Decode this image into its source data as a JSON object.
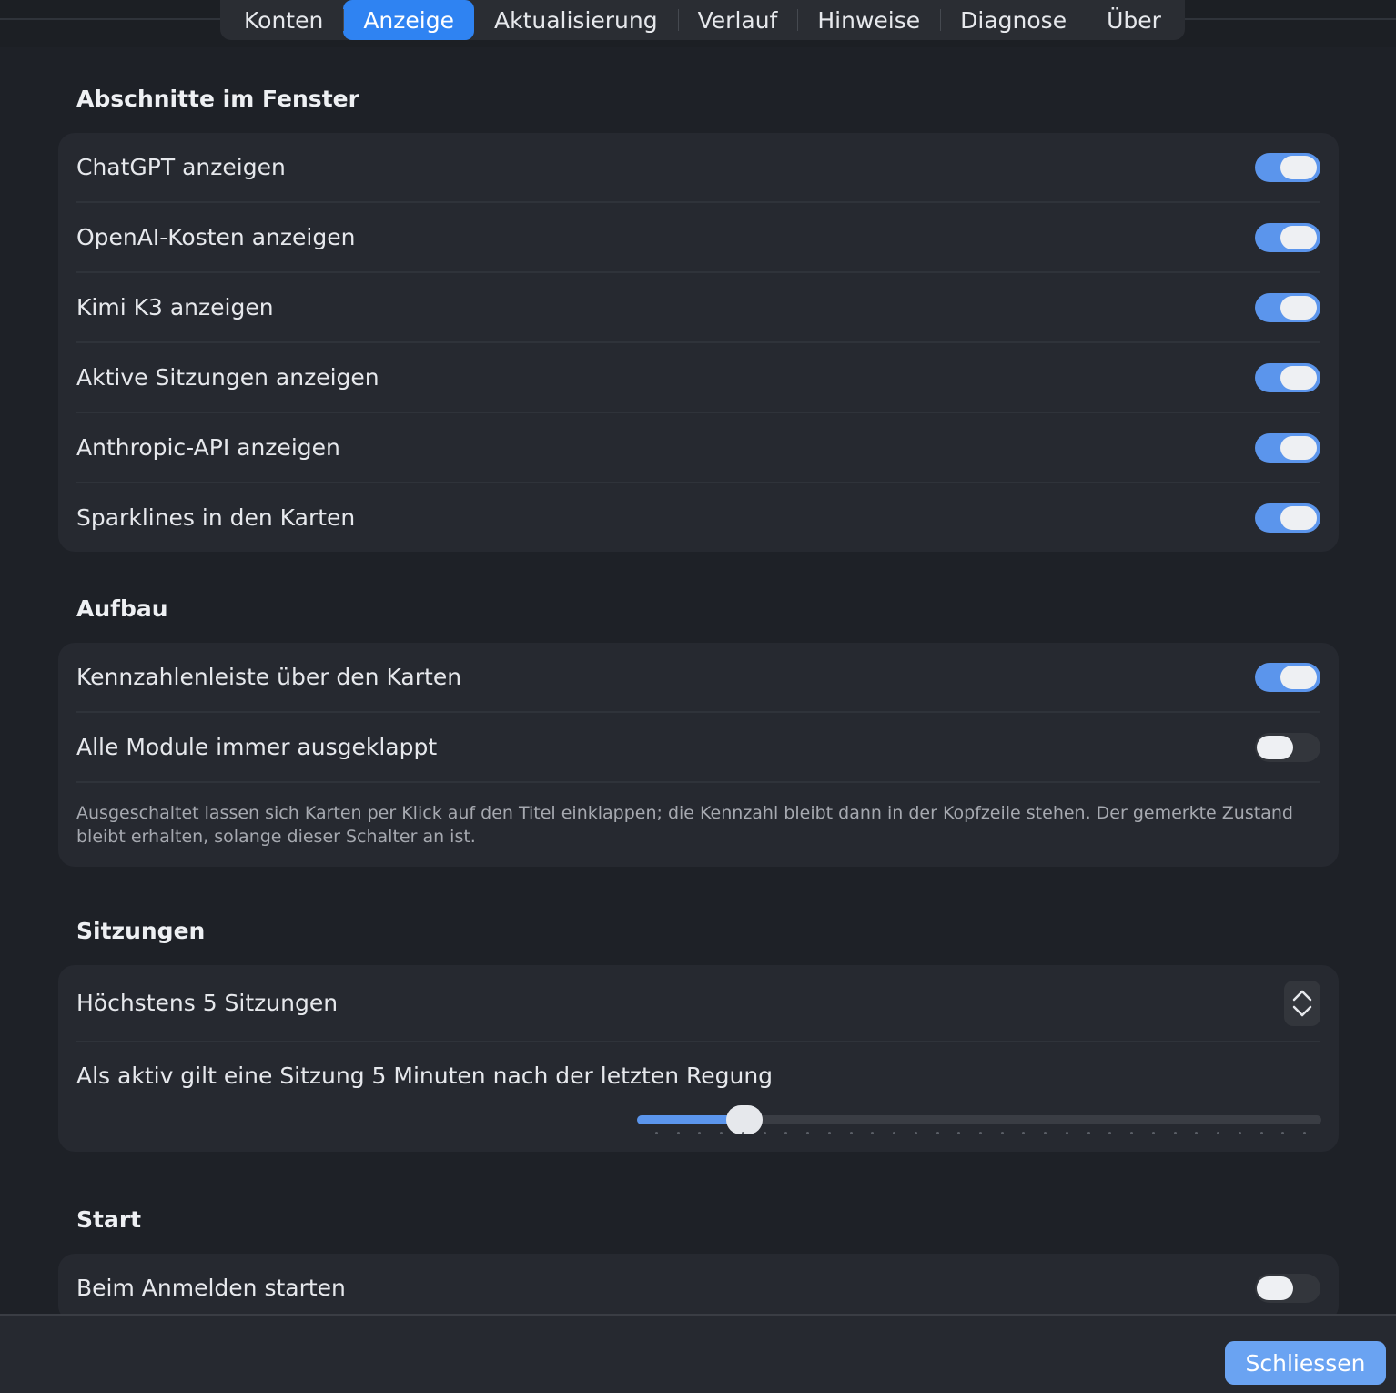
{
  "tabs": [
    {
      "label": "Konten",
      "active": false
    },
    {
      "label": "Anzeige",
      "active": true
    },
    {
      "label": "Aktualisierung",
      "active": false
    },
    {
      "label": "Verlauf",
      "active": false
    },
    {
      "label": "Hinweise",
      "active": false
    },
    {
      "label": "Diagnose",
      "active": false
    },
    {
      "label": "Über",
      "active": false
    }
  ],
  "sections": {
    "fenster": {
      "title": "Abschnitte im Fenster",
      "rows": [
        {
          "label": "ChatGPT anzeigen",
          "on": true
        },
        {
          "label": "OpenAI-Kosten anzeigen",
          "on": true
        },
        {
          "label": "Kimi K3 anzeigen",
          "on": true
        },
        {
          "label": "Aktive Sitzungen anzeigen",
          "on": true
        },
        {
          "label": "Anthropic-API anzeigen",
          "on": true
        },
        {
          "label": "Sparklines in den Karten",
          "on": true
        }
      ]
    },
    "aufbau": {
      "title": "Aufbau",
      "rows": [
        {
          "label": "Kennzahlenleiste über den Karten",
          "on": true
        },
        {
          "label": "Alle Module immer ausgeklappt",
          "on": false
        }
      ],
      "hint": "Ausgeschaltet lassen sich Karten per Klick auf den Titel einklappen; die Kennzahl bleibt dann in der Kopfzeile stehen. Der gemerkte Zustand bleibt erhalten, solange dieser Schalter an ist."
    },
    "sitzungen": {
      "title": "Sitzungen",
      "max_label": "Höchstens 5 Sitzungen",
      "active_label": "Als aktiv gilt eine Sitzung 5 Minuten nach der letzten Regung",
      "slider_fraction": 0.157
    },
    "start": {
      "title": "Start",
      "rows": [
        {
          "label": "Beim Anmelden starten",
          "on": false
        }
      ]
    }
  },
  "footer": {
    "close_label": "Schliessen"
  },
  "colors": {
    "accent": "#2f83f2",
    "toggle_on": "#5b95ec",
    "close_button": "#6aa3f2"
  }
}
